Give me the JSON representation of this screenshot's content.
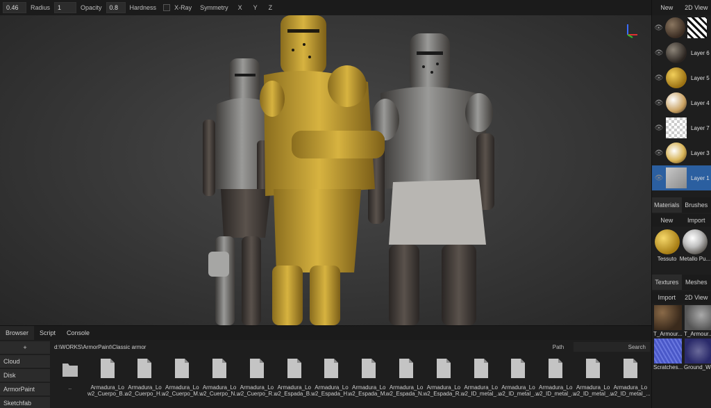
{
  "toolbar": {
    "size_value": "0.46",
    "radius_label": "Radius",
    "radius_value": "1",
    "opacity_label": "Opacity",
    "opacity_value": "0.8",
    "hardness_label": "Hardness",
    "xray_label": "X-Ray",
    "symmetry_label": "Symmetry",
    "axis_x": "X",
    "axis_y": "Y",
    "axis_z": "Z"
  },
  "layers_panel": {
    "new_label": "New",
    "view_2d_label": "2D View",
    "layers": [
      {
        "name": "",
        "thumb": "dark-sphere"
      },
      {
        "name": "Layer 6",
        "thumb": "dark-sphere"
      },
      {
        "name": "Layer 5",
        "thumb": "gold-sphere"
      },
      {
        "name": "Layer 4",
        "thumb": "light-sphere"
      },
      {
        "name": "Layer 7",
        "thumb": "transparent-mask"
      },
      {
        "name": "Layer 3",
        "thumb": "gold-light-sphere"
      },
      {
        "name": "Layer 1",
        "thumb": "knight-mask",
        "selected": true
      }
    ]
  },
  "materials_panel": {
    "tabs": [
      "Materials",
      "Brushes"
    ],
    "new_label": "New",
    "import_label": "Import",
    "items": [
      {
        "name": "Tessuto",
        "thumb": "gold"
      },
      {
        "name": "Metallo Pu...",
        "thumb": "metal"
      }
    ]
  },
  "textures_panel": {
    "tabs": [
      "Textures",
      "Meshes"
    ],
    "import_label": "Import",
    "view_2d_label": "2D View",
    "items": [
      {
        "name": "T_Armour...",
        "thumb": "rusty"
      },
      {
        "name": "T_Armour...",
        "thumb": "grey"
      },
      {
        "name": "Scratches...",
        "thumb": "blue"
      },
      {
        "name": "Ground_W...",
        "thumb": "blue-ground"
      }
    ]
  },
  "browser": {
    "tabs": [
      "Browser",
      "Script",
      "Console"
    ],
    "sidebar_items": [
      "+",
      "Cloud",
      "Disk",
      "ArmorPaint",
      "Sketchfab"
    ],
    "path": "d:\\WORKS\\ArmorPaint\\Classic armor",
    "path_label": "Path",
    "search_label": "Search",
    "files": [
      {
        "line1": "..",
        "line2": "",
        "type": "folder"
      },
      {
        "line1": "Armadura_Lo",
        "line2": "w2_Cuerpo_B...",
        "type": "file"
      },
      {
        "line1": "Armadura_Lo",
        "line2": "w2_Cuerpo_H...",
        "type": "file"
      },
      {
        "line1": "Armadura_Lo",
        "line2": "w2_Cuerpo_M...",
        "type": "file"
      },
      {
        "line1": "Armadura_Lo",
        "line2": "w2_Cuerpo_N...",
        "type": "file"
      },
      {
        "line1": "Armadura_Lo",
        "line2": "w2_Cuerpo_R...",
        "type": "file"
      },
      {
        "line1": "Armadura_Lo",
        "line2": "w2_Espada_B...",
        "type": "file"
      },
      {
        "line1": "Armadura_Lo",
        "line2": "w2_Espada_H...",
        "type": "file"
      },
      {
        "line1": "Armadura_Lo",
        "line2": "w2_Espada_M...",
        "type": "file"
      },
      {
        "line1": "Armadura_Lo",
        "line2": "w2_Espada_N...",
        "type": "file"
      },
      {
        "line1": "Armadura_Lo",
        "line2": "w2_Espada_R...",
        "type": "file"
      },
      {
        "line1": "Armadura_Lo",
        "line2": "w2_ID_metal_...",
        "type": "file"
      },
      {
        "line1": "Armadura_Lo",
        "line2": "w2_ID_metal_...",
        "type": "file"
      },
      {
        "line1": "Armadura_Lo",
        "line2": "w2_ID_metal_...",
        "type": "file"
      },
      {
        "line1": "Armadura_Lo",
        "line2": "w2_ID_metal_...",
        "type": "file"
      },
      {
        "line1": "Armadura_Lo",
        "line2": "w2_ID_metal_...",
        "type": "file"
      }
    ]
  },
  "colors": {
    "selected": "#2b5fa0",
    "panel": "#1e1e1e",
    "gold": "#c9a52a"
  }
}
